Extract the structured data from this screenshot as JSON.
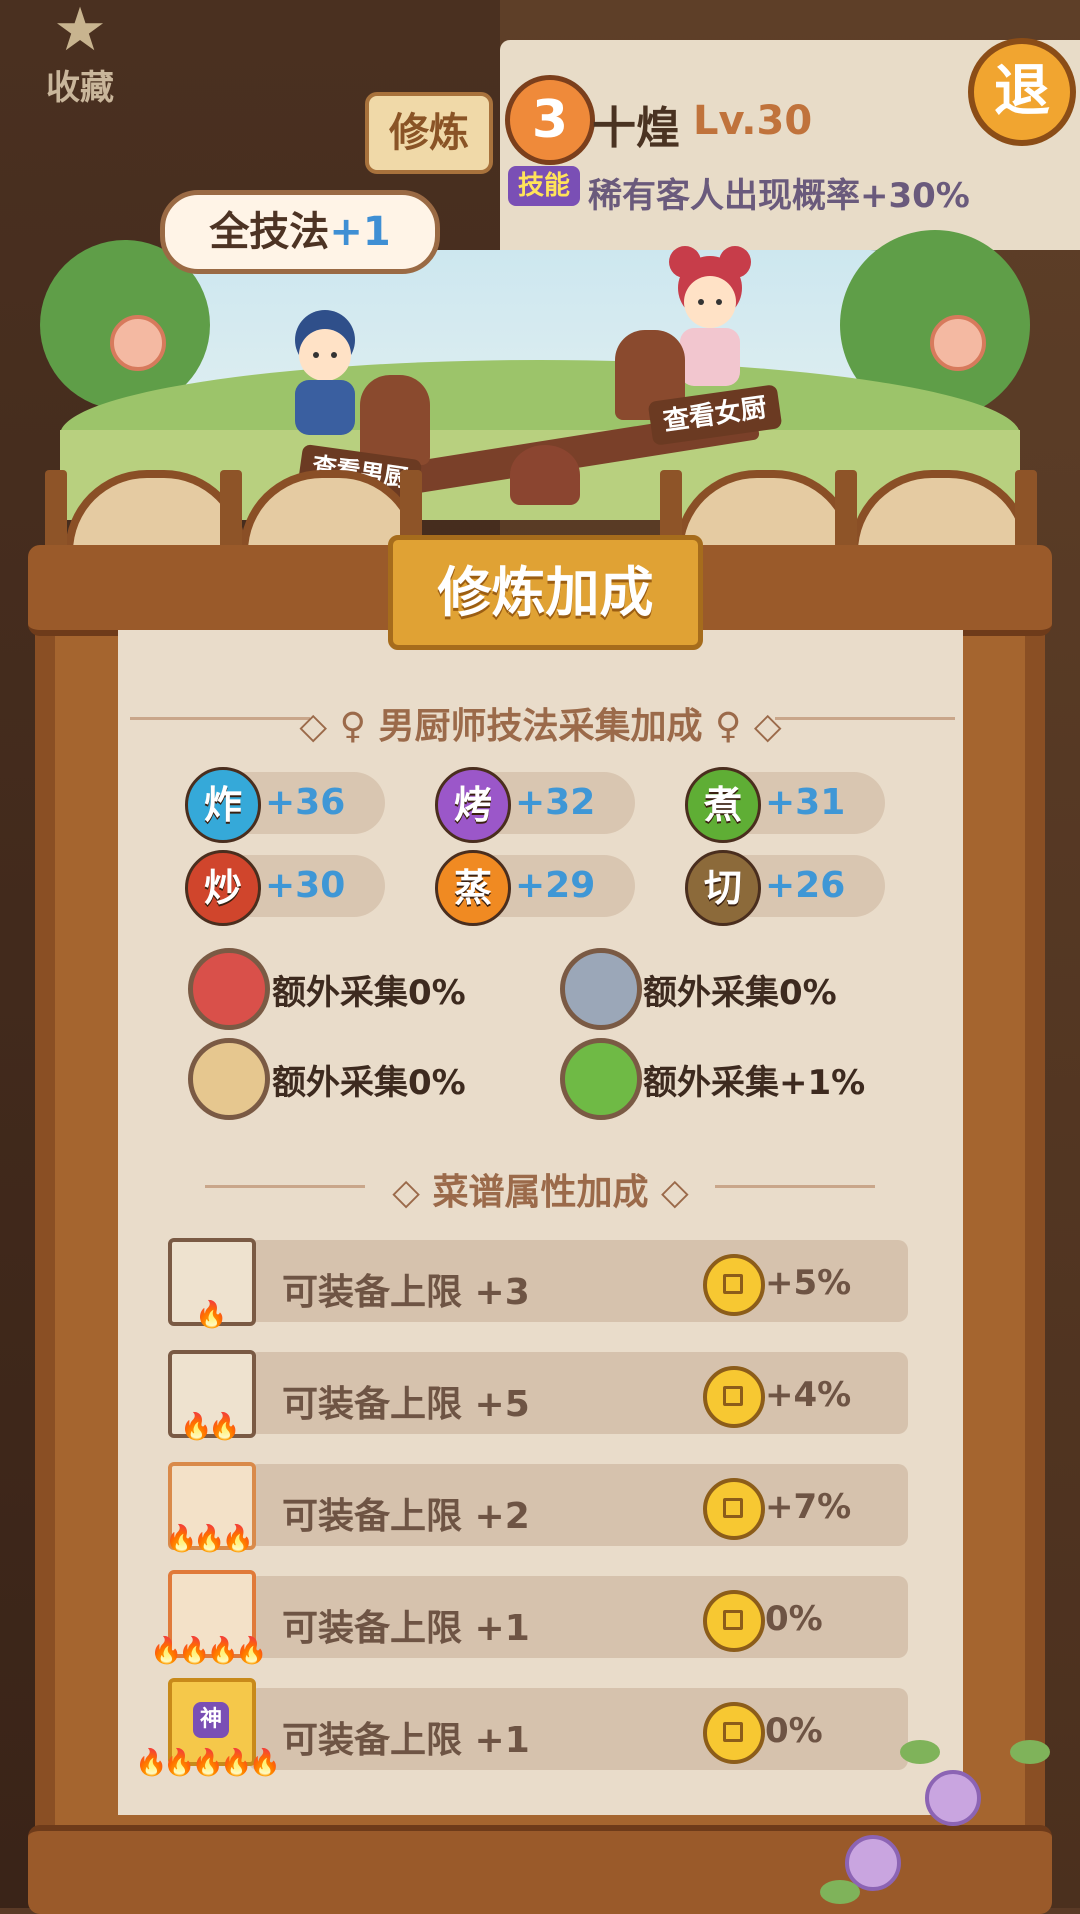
{
  "background": {
    "favorites_label": "收藏",
    "train_button": "修炼",
    "chef_rank": "3",
    "chef_name": "十煌",
    "chef_level": "Lv.30",
    "exit_button": "退",
    "skill_tag": "技能",
    "skill_desc": "稀有客人出现概率+30%"
  },
  "scene": {
    "bubble_text": "全技法",
    "bubble_bonus": "+1",
    "view_female": "查看女厨",
    "view_male": "查看男厨"
  },
  "panel": {
    "title": "修炼加成",
    "section1_title": "男厨师技法采集加成",
    "skills": [
      {
        "char": "炸",
        "value": "+36",
        "color": "#35a9d9"
      },
      {
        "char": "烤",
        "value": "+32",
        "color": "#9b57c9"
      },
      {
        "char": "煮",
        "value": "+31",
        "color": "#5fae35"
      },
      {
        "char": "炒",
        "value": "+30",
        "color": "#d0452c"
      },
      {
        "char": "蒸",
        "value": "+29",
        "color": "#f08a22"
      },
      {
        "char": "切",
        "value": "+26",
        "color": "#8c6a3a"
      }
    ],
    "gathers": [
      {
        "icon": "meat-icon",
        "text": "额外采集0%"
      },
      {
        "icon": "fish-icon",
        "text": "额外采集0%"
      },
      {
        "icon": "flour-icon",
        "text": "额外采集0%"
      },
      {
        "icon": "vegetable-icon",
        "text": "额外采集+1%"
      }
    ],
    "section2_title": "菜谱属性加成",
    "recipes": [
      {
        "label": "可装备上限 +3",
        "value": "+5%",
        "flames": 1
      },
      {
        "label": "可装备上限 +5",
        "value": "+4%",
        "flames": 2
      },
      {
        "label": "可装备上限 +2",
        "value": "+7%",
        "flames": 3
      },
      {
        "label": "可装备上限 +1",
        "value": "0%",
        "flames": 4
      },
      {
        "label": "可装备上限 +1",
        "value": "0%",
        "flames": 5,
        "badge": "神"
      }
    ],
    "colors": {
      "accent_blue": "#3f97d6",
      "panel_bg": "#e9dcca",
      "frame": "#8a4f24"
    }
  }
}
